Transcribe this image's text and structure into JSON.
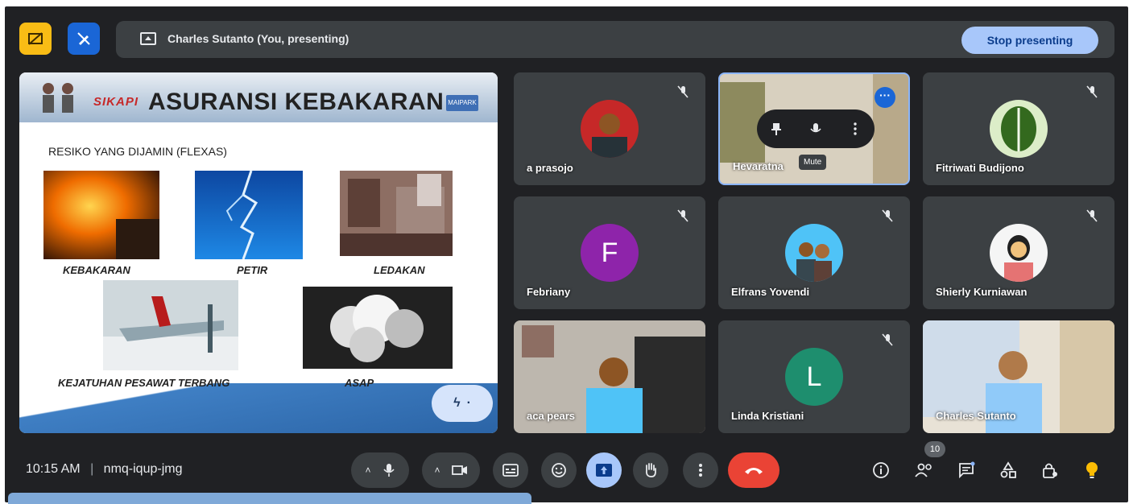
{
  "presenting": {
    "text": "Charles Sutanto (You, presenting)",
    "stop_label": "Stop presenting"
  },
  "slide": {
    "brand": "SIKAPI",
    "title": "ASURANSI KEBAKARAN",
    "badge": "MAIPARK",
    "subtitle": "RESIKO YANG DIJAMIN (FLEXAS)",
    "captions": [
      "KEBAKARAN",
      "PETIR",
      "LEDAKAN",
      "KEJATUHAN PESAWAT TERBANG",
      "ASAP"
    ]
  },
  "tiles": [
    {
      "name": "a prasojo",
      "muted": true
    },
    {
      "name": "Hevaratna",
      "muted": false,
      "tooltip": "Mute"
    },
    {
      "name": "Fitriwati Budijono",
      "muted": true
    },
    {
      "name": "Febriany",
      "initial": "F",
      "muted": true
    },
    {
      "name": "Elfrans Yovendi",
      "muted": true
    },
    {
      "name": "Shierly Kurniawan",
      "muted": true
    },
    {
      "name": "aca pears",
      "muted": false
    },
    {
      "name": "Linda Kristiani",
      "initial": "L",
      "muted": true
    },
    {
      "name": "Charles Sutanto",
      "muted": false
    }
  ],
  "bottom": {
    "time": "10:15 AM",
    "meeting_code": "nmq-iqup-jmg",
    "participant_count": "10"
  },
  "colors": {
    "background": "#202124",
    "tile": "#3c4043",
    "accent": "#a8c7fa",
    "end_call": "#ea4335",
    "febriany_avatar": "#8e24aa",
    "linda_avatar": "#1e8e6e"
  }
}
